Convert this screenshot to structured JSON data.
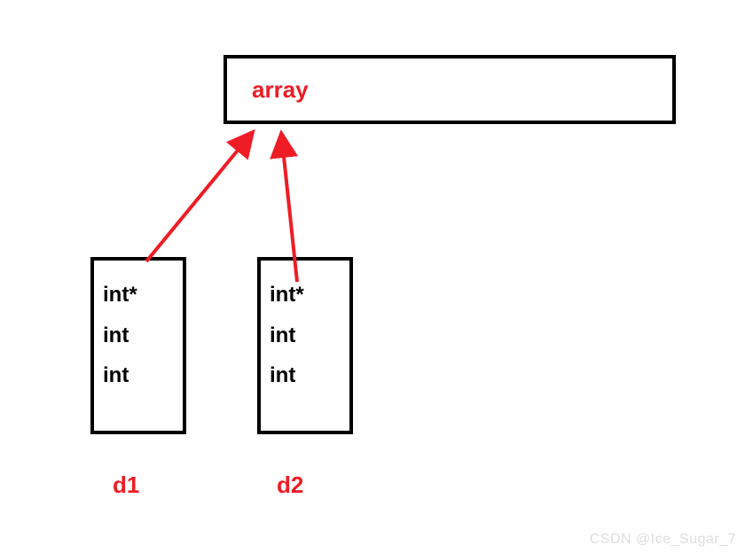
{
  "array": {
    "label": "array"
  },
  "d1": {
    "label": "d1",
    "fields": {
      "f0": "int*",
      "f1": "int",
      "f2": "int"
    }
  },
  "d2": {
    "label": "d2",
    "fields": {
      "f0": "int*",
      "f1": "int",
      "f2": "int"
    }
  },
  "watermark": "CSDN @Ice_Sugar_7",
  "colors": {
    "accent": "#ee1c25",
    "border": "#000000"
  }
}
